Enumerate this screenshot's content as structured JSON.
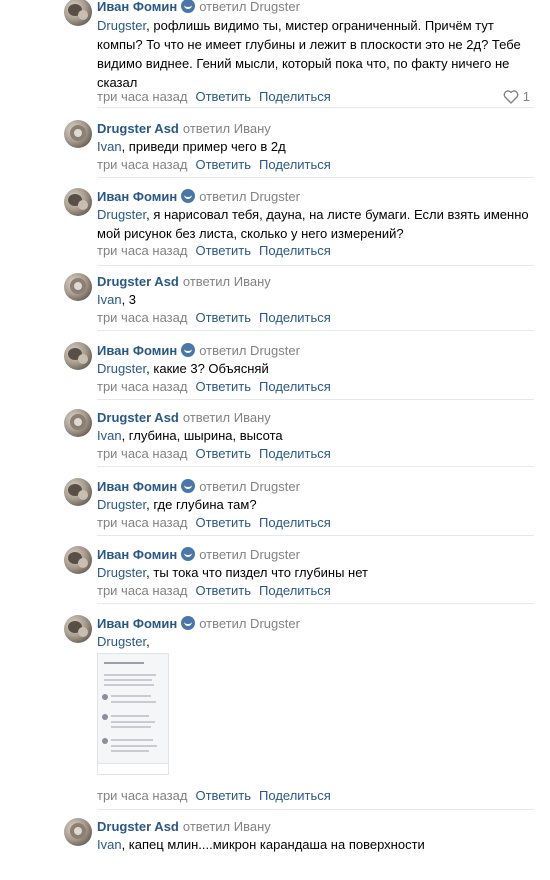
{
  "actions": {
    "reply": "Ответить",
    "share": "Поделиться"
  },
  "comments": [
    {
      "author": "Иван Фомин",
      "verified": true,
      "replied": "ответил Drugster",
      "mention": "Drugster",
      "text": ", рофлишь видимо ты, мистер ограниченный. Причём тут компы? То что не имеет глубины и лежит в плоскости это не 2д? Тебе видимо виднее. Гений мысли, который пока что, по факту ничего не сказал",
      "time": "три часа назад",
      "likes": "1"
    },
    {
      "author": "Drugster Asd",
      "verified": false,
      "replied": "ответил Ивану",
      "mention": "Ivan",
      "text": ", приведи пример чего в 2д",
      "time": "три часа назад"
    },
    {
      "author": "Иван Фомин",
      "verified": true,
      "replied": "ответил Drugster",
      "mention": "Drugster",
      "text": ", я нарисовал тебя, дауна, на листе бумаги. Если взять именно мой рисунок без листа, сколько у него измерений?",
      "time": "три часа назад"
    },
    {
      "author": "Drugster Asd",
      "verified": false,
      "replied": "ответил Ивану",
      "mention": "Ivan",
      "text": ", 3",
      "time": "три часа назад"
    },
    {
      "author": "Иван Фомин",
      "verified": true,
      "replied": "ответил Drugster",
      "mention": "Drugster",
      "text": ", какие 3? Объясняй",
      "time": "три часа назад"
    },
    {
      "author": "Drugster Asd",
      "verified": false,
      "replied": "ответил Ивану",
      "mention": "Ivan",
      "text": ", глубина, шырина, высота",
      "time": "три часа назад"
    },
    {
      "author": "Иван Фомин",
      "verified": true,
      "replied": "ответил Drugster",
      "mention": "Drugster",
      "text": ", где глубина там?",
      "time": "три часа назад"
    },
    {
      "author": "Иван Фомин",
      "verified": true,
      "replied": "ответил Drugster",
      "mention": "Drugster",
      "text": ", ты тока что пиздел что глубины нет",
      "time": "три часа назад"
    },
    {
      "author": "Иван Фомин",
      "verified": true,
      "replied": "ответил Drugster",
      "mention": "Drugster",
      "text": ",",
      "time": "три часа назад",
      "has_image": true
    },
    {
      "author": "Drugster Asd",
      "verified": false,
      "replied": "ответил Ивану",
      "mention": "Ivan",
      "text": ", капец млин....микрон карандаша на поверхности",
      "time": ""
    }
  ]
}
